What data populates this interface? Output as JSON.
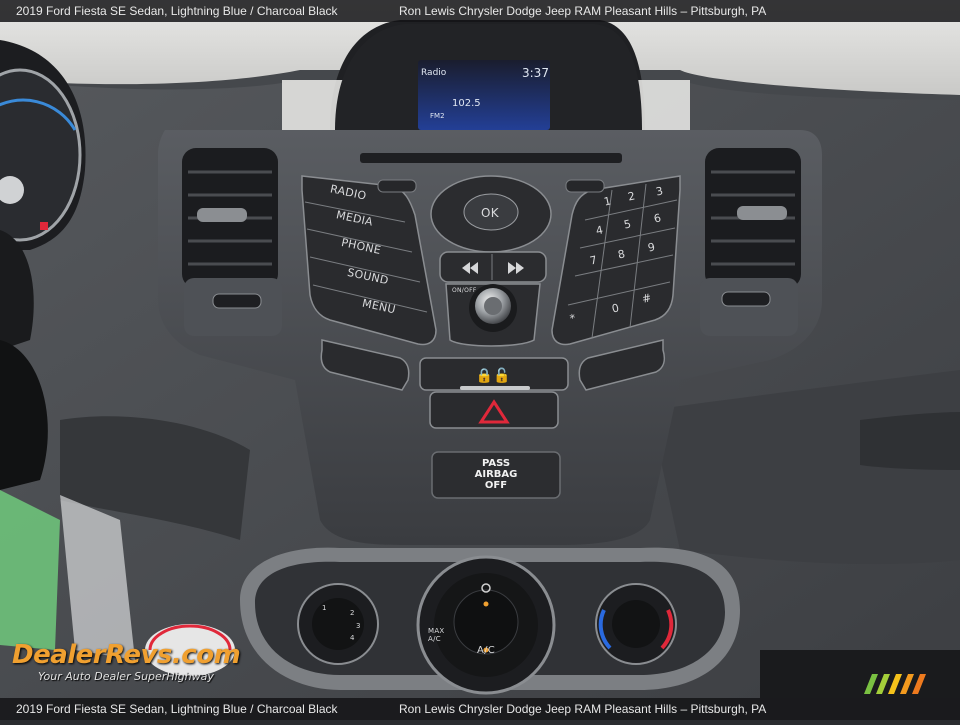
{
  "caption": {
    "left": "2019 Ford Fiesta SE Sedan,  Lightning Blue / Charcoal Black",
    "right": "Ron Lewis Chrysler Dodge Jeep RAM Pleasant Hills – Pittsburgh, PA"
  },
  "screen": {
    "source": "Radio",
    "time": "3:37",
    "frequency": "102.5",
    "band": "FM2"
  },
  "buttons": {
    "radio": "RADIO",
    "media": "MEDIA",
    "phone": "PHONE",
    "sound": "SOUND",
    "menu": "MENU",
    "ok": "OK",
    "onoff": "ON/OFF",
    "keypad": [
      "1",
      "2",
      "3",
      "4",
      "5",
      "6",
      "7",
      "8",
      "9",
      "*",
      "0",
      "#"
    ]
  },
  "airbag": {
    "line1": "PASS",
    "line2": "AIRBAG",
    "line3": "OFF"
  },
  "climate": {
    "max_ac": "MAX\nA/C",
    "ac": "A/C",
    "fan_speeds": [
      "1",
      "2",
      "3",
      "4"
    ]
  },
  "watermark": {
    "brand": "DealerRevs.com",
    "tagline": "Your Auto Dealer SuperHighway"
  },
  "colors": {
    "logo_orange": "#f0a030",
    "hazard_red": "#e0283a",
    "screen_blue": "#1c3a8a"
  }
}
